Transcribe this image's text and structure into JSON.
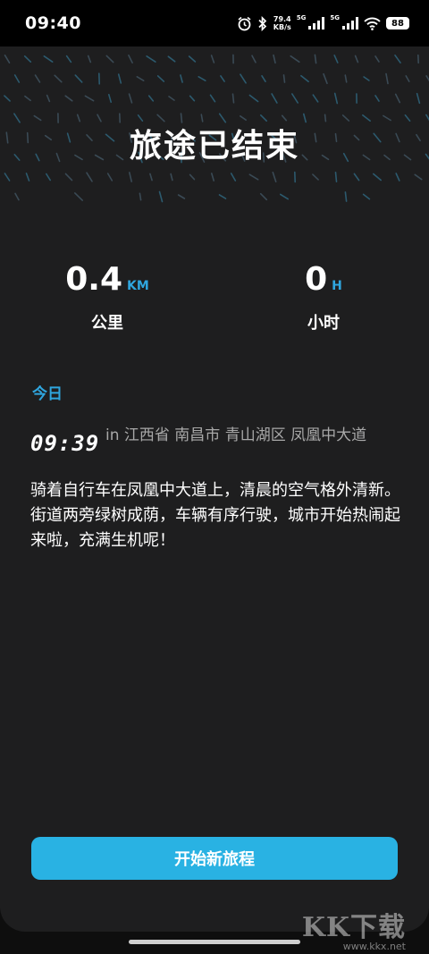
{
  "status_bar": {
    "time": "09:40",
    "net_speed_value": "79.4",
    "net_speed_unit": "KB/s",
    "sim1": "5G",
    "sim2": "5G",
    "battery": "88"
  },
  "header": {
    "title": "旅途已结束"
  },
  "stats": [
    {
      "value": "0.4",
      "unit": "KM",
      "label": "公里"
    },
    {
      "value": "0",
      "unit": "H",
      "label": "小时"
    }
  ],
  "journal": {
    "section_label": "今日",
    "entry": {
      "time": "09:39",
      "location": "in 江西省 南昌市 青山湖区 凤凰中大道",
      "text": "骑着自行车在凤凰中大道上，清晨的空气格外清新。街道两旁绿树成荫，车辆有序行驶，城市开始热闹起来啦，充满生机呢！"
    }
  },
  "actions": {
    "start_label": "开始新旅程"
  },
  "watermark": {
    "logo": "KK下载",
    "url": "www.kkx.net"
  },
  "colors": {
    "accent": "#2fa6df",
    "button": "#29b2e3",
    "card": "#1e1e1f",
    "background": "#0e0e0e"
  },
  "icons": [
    "alarm-icon",
    "bluetooth-icon",
    "signal-icon",
    "wifi-icon",
    "battery-icon"
  ]
}
